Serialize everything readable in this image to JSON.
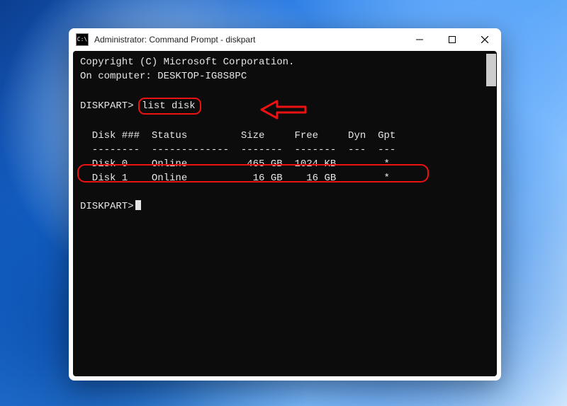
{
  "window": {
    "title": "Administrator: Command Prompt - diskpart",
    "icon_label": "C:\\"
  },
  "terminal": {
    "copyright": "Copyright (C) Microsoft Corporation.",
    "computer_line": "On computer: DESKTOP-IG8S8PC",
    "prompt1_prefix": "DISKPART>",
    "command": "list disk",
    "header": "  Disk ###  Status         Size     Free     Dyn  Gpt",
    "divider": "  --------  -------------  -------  -------  ---  ---",
    "rows": [
      "  Disk 0    Online          465 GB  1024 KB        *",
      "  Disk 1    Online           16 GB    16 GB        *"
    ],
    "prompt2": "DISKPART>"
  },
  "chart_data": {
    "type": "table",
    "title": "DISKPART list disk",
    "columns": [
      "Disk ###",
      "Status",
      "Size",
      "Free",
      "Dyn",
      "Gpt"
    ],
    "rows": [
      {
        "Disk ###": "Disk 0",
        "Status": "Online",
        "Size": "465 GB",
        "Free": "1024 KB",
        "Dyn": "",
        "Gpt": "*"
      },
      {
        "Disk ###": "Disk 1",
        "Status": "Online",
        "Size": "16 GB",
        "Free": "16 GB",
        "Dyn": "",
        "Gpt": "*"
      }
    ]
  },
  "annotations": {
    "command_highlight": "list disk",
    "row_highlight_index": 1,
    "arrow_color": "#e11"
  }
}
